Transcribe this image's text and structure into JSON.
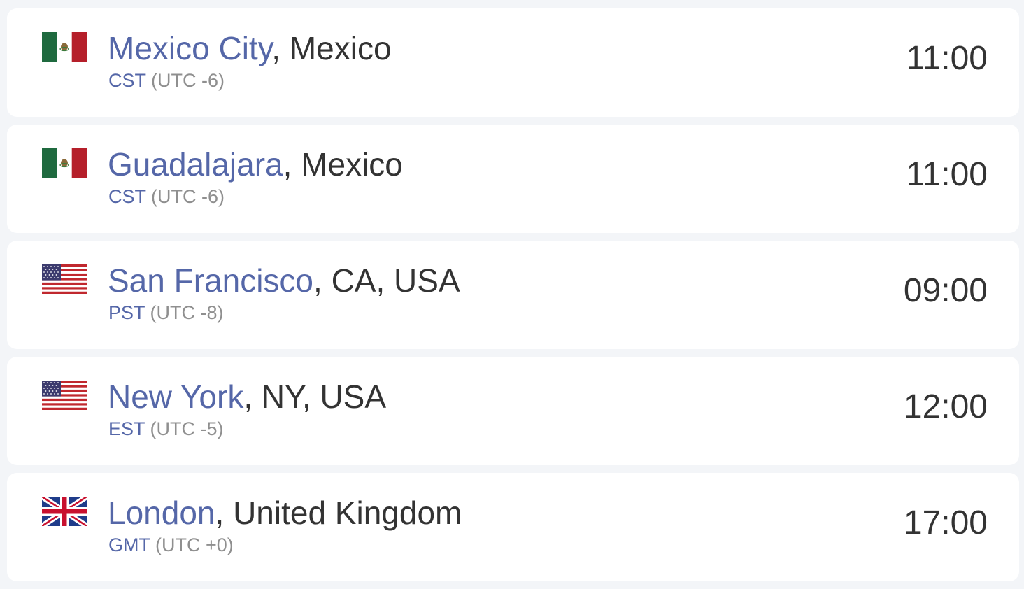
{
  "rows": [
    {
      "flag": "mexico-flag",
      "city": "Mexico City",
      "region": "Mexico",
      "tz_abbr": "CST",
      "tz_offset": "(UTC -6)",
      "time": "11:00"
    },
    {
      "flag": "mexico-flag",
      "city": "Guadalajara",
      "region": "Mexico",
      "tz_abbr": "CST",
      "tz_offset": "(UTC -6)",
      "time": "11:00"
    },
    {
      "flag": "usa-flag",
      "city": "San Francisco",
      "region": "CA, USA",
      "tz_abbr": "PST",
      "tz_offset": "(UTC -8)",
      "time": "09:00"
    },
    {
      "flag": "usa-flag",
      "city": "New York",
      "region": "NY, USA",
      "tz_abbr": "EST",
      "tz_offset": "(UTC -5)",
      "time": "12:00"
    },
    {
      "flag": "uk-flag",
      "city": "London",
      "region": "United Kingdom",
      "tz_abbr": "GMT",
      "tz_offset": "(UTC +0)",
      "time": "17:00"
    }
  ],
  "separator": ", ",
  "colors": {
    "city": "#5567a8",
    "text": "#333333",
    "muted": "#8f8f8f",
    "background": "#f3f5f8"
  }
}
